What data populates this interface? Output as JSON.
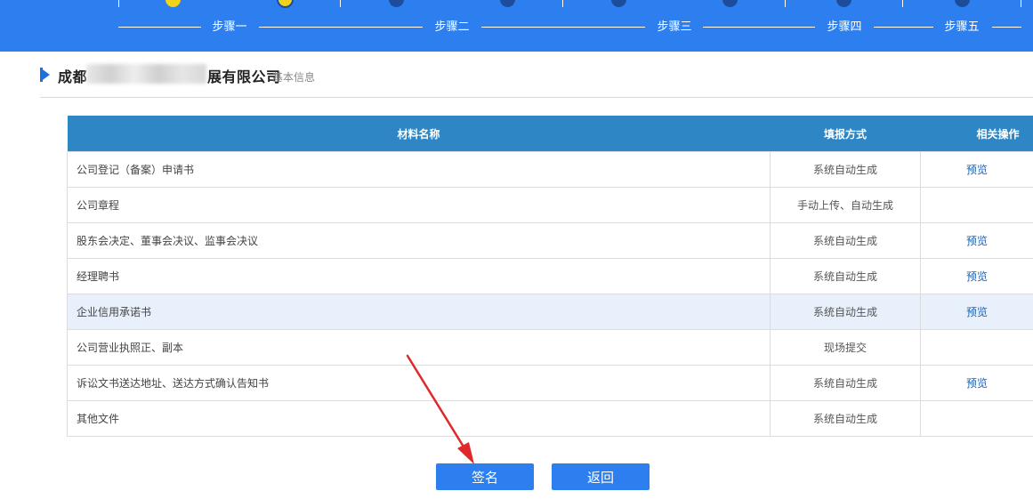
{
  "steps": [
    {
      "label": "步骤一",
      "state": "done"
    },
    {
      "label": "步骤二",
      "state": "todo"
    },
    {
      "label": "步骤三",
      "state": "todo"
    },
    {
      "label": "步骤四",
      "state": "todo"
    },
    {
      "label": "步骤五",
      "state": "todo"
    }
  ],
  "section": {
    "company_prefix": "成都",
    "company_suffix": "展有限公司",
    "subtitle": "基本信息"
  },
  "table": {
    "headers": [
      "材料名称",
      "填报方式",
      "相关操作"
    ],
    "rows": [
      {
        "name": "公司登记（备案）申请书",
        "method": "系统自动生成",
        "op": "预览"
      },
      {
        "name": "公司章程",
        "method": "手动上传、自动生成",
        "op": ""
      },
      {
        "name": "股东会决定、董事会决议、监事会决议",
        "method": "系统自动生成",
        "op": "预览"
      },
      {
        "name": "经理聘书",
        "method": "系统自动生成",
        "op": "预览"
      },
      {
        "name": "企业信用承诺书",
        "method": "系统自动生成",
        "op": "预览"
      },
      {
        "name": "公司营业执照正、副本",
        "method": "现场提交",
        "op": ""
      },
      {
        "name": "诉讼文书送达地址、送达方式确认告知书",
        "method": "系统自动生成",
        "op": "预览"
      },
      {
        "name": "其他文件",
        "method": "系统自动生成",
        "op": ""
      }
    ]
  },
  "buttons": {
    "sign": "签名",
    "back": "返回"
  },
  "colors": {
    "header_blue": "#2d7ff0",
    "table_header": "#2e86c5",
    "step_done": "#f2d21b",
    "step_todo": "#1d4d9a",
    "arrow": "#e0282b"
  }
}
